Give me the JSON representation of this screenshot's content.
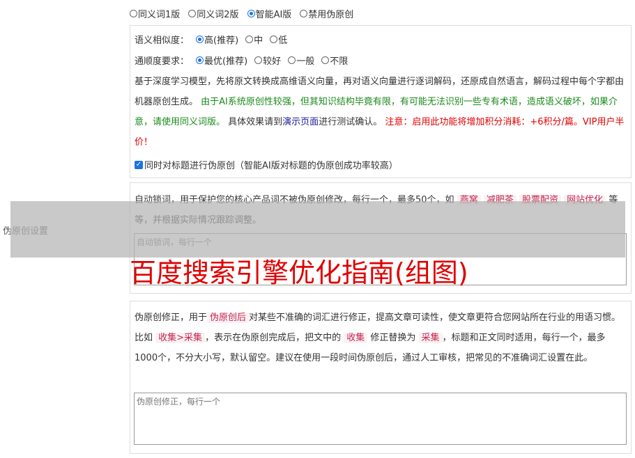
{
  "side_label": "伪原创设置",
  "versions": [
    {
      "label": "同义词1版",
      "selected": false
    },
    {
      "label": "同义词2版",
      "selected": false
    },
    {
      "label": "智能AI版",
      "selected": true
    },
    {
      "label": "禁用伪原创",
      "selected": false
    }
  ],
  "similarity": {
    "label": "语义相似度：",
    "options": [
      {
        "label": "高(推荐)",
        "selected": true
      },
      {
        "label": "中",
        "selected": false
      },
      {
        "label": "低",
        "selected": false
      }
    ]
  },
  "fluency": {
    "label": "通顺度要求：",
    "options": [
      {
        "label": "最优(推荐)",
        "selected": true
      },
      {
        "label": "较好",
        "selected": false
      },
      {
        "label": "一般",
        "selected": false
      },
      {
        "label": "不限",
        "selected": false
      }
    ]
  },
  "ai_desc": {
    "p1": "基于深度学习模型，先将原文转换成高维语义向量，再对语义向量进行逐词解码，还原成自然语言，解码过程中每个字都由机器原创生成。",
    "p2_green": "由于AI系统原创性较强，但其知识结构毕竟有限，有可能无法识别一些专有术语，造成语义破坏，如果介意，请使用同义词版。",
    "p3": "具体效果请到",
    "demo_link": "演示页面",
    "p4": "进行测试确认。",
    "p5_red": "注意：启用此功能将增加积分消耗：+6积分/篇。VIP用户半价！"
  },
  "title_checkbox": {
    "label": "同时对标题进行伪原创（智能AI版对标题的伪原创成功率较高）",
    "checked": true
  },
  "lock_words": {
    "desc1": "自动锁词，用于保护您的核心产品词不被伪原创修改，每行一个，最多50个，如",
    "tag1": "燕窝",
    "tag2": "减肥茶",
    "tag3": "股票配资",
    "tag4": "网站优化",
    "desc2": "等等，并根据实际情况跟踪调整。",
    "placeholder": "自动锁词，每行一个"
  },
  "corrections": {
    "d1": "伪原创修正，用于",
    "t1": "伪原创后",
    "d2": "对某些不准确的词汇进行修正，提高文章可读性，使文章更符合您网站所在行业的用语习惯。比如",
    "t2": "收集>采集",
    "d3": "，表示在伪原创完成后，把文中的",
    "t3": "收集",
    "d4": "修正替换为",
    "t4": "采集",
    "d5": "，标题和正文同时适用，每行一个，最多1000个，不分大小写，默认留空。建议在使用一段时间伪原创后，通过人工审核，把常见的不准确词汇设置在此。",
    "placeholder": "伪原创修正，每行一个"
  },
  "overlay_title": "百度搜索引擎优化指南(组图)",
  "colors": {
    "accent": "#1a73e8",
    "green": "#1a8a1a",
    "red": "#e00000",
    "link": "#1a1a9a"
  }
}
